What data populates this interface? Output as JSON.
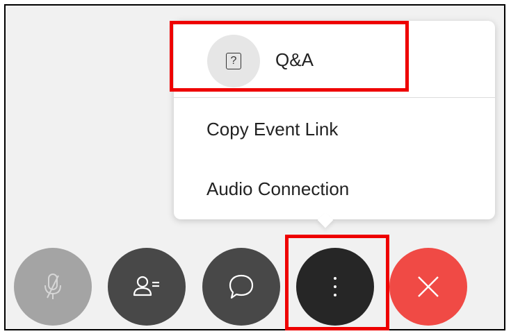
{
  "menu": {
    "items": [
      {
        "label": "Q&A",
        "icon": "question-icon",
        "icon_glyph": "?"
      },
      {
        "label": "Copy Event Link"
      },
      {
        "label": "Audio Connection"
      }
    ]
  },
  "toolbar": {
    "buttons": [
      {
        "name": "mute",
        "icon": "microphone-muted-icon"
      },
      {
        "name": "participants",
        "icon": "participants-icon"
      },
      {
        "name": "chat",
        "icon": "chat-bubble-icon"
      },
      {
        "name": "more-options",
        "icon": "more-vertical-icon"
      },
      {
        "name": "leave",
        "icon": "close-icon"
      }
    ]
  },
  "colors": {
    "highlight": "#ee0000",
    "leave_button": "#f04a45",
    "dark_button": "#484848",
    "more_button": "#262626",
    "disabled_button": "#a4a4a4"
  }
}
